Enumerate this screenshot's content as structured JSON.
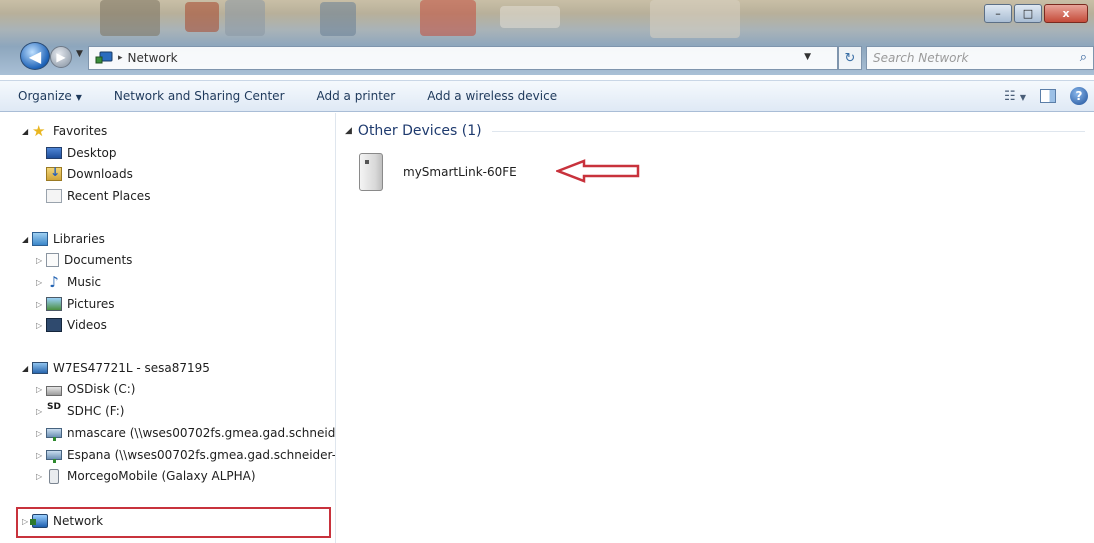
{
  "window": {
    "min_glyph": "–",
    "max_glyph": "□",
    "close_glyph": "x"
  },
  "address_bar": {
    "back_glyph": "◀",
    "forward_glyph": "▶",
    "location": "Network",
    "separator": "▸"
  },
  "search": {
    "placeholder": "Search Network",
    "icon": "search-icon"
  },
  "toolbar": {
    "organize": "Organize",
    "network_sharing": "Network and Sharing Center",
    "add_printer": "Add a printer",
    "add_wireless": "Add a wireless device"
  },
  "navigation": {
    "favorites": {
      "label": "Favorites",
      "items": [
        "Desktop",
        "Downloads",
        "Recent Places"
      ]
    },
    "libraries": {
      "label": "Libraries",
      "items": [
        "Documents",
        "Music",
        "Pictures",
        "Videos"
      ]
    },
    "computer": {
      "label": "W7ES47721L - sesa87195",
      "items": [
        "OSDisk (C:)",
        "SDHC (F:)",
        "nmascare (\\\\wses00702fs.gmea.gad.schneide",
        "Espana (\\\\wses00702fs.gmea.gad.schneider-e",
        "MorcegoMobile (Galaxy ALPHA)"
      ],
      "sd_label": "SD"
    },
    "network": {
      "label": "Network"
    }
  },
  "content": {
    "group_title": "Other Devices (1)",
    "devices": [
      {
        "name": "mySmartLink-60FE",
        "icon": "device-icon"
      }
    ]
  },
  "colors": {
    "highlight": "#c8323c",
    "group_title": "#1e3a6e",
    "toolbar_text": "#1e395b"
  }
}
